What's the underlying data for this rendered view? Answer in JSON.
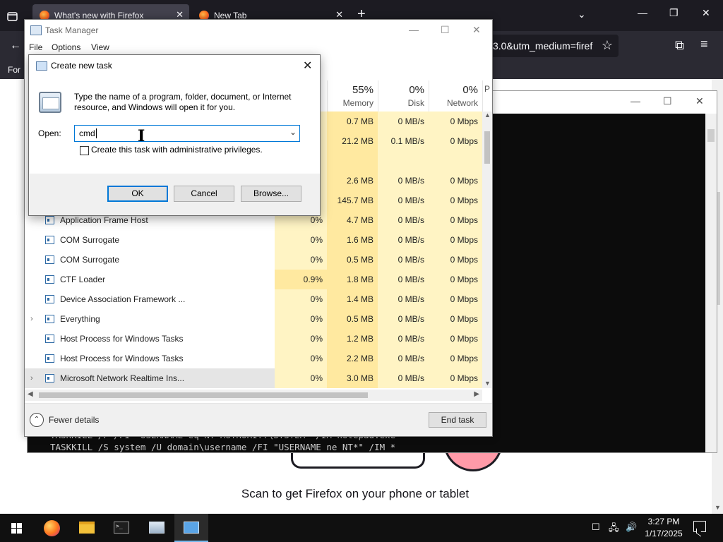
{
  "firefox": {
    "tabs": [
      {
        "title": "What's new with Firefox",
        "close": "✕"
      },
      {
        "title": "New Tab",
        "close": "✕"
      }
    ],
    "new_tab": "+",
    "all_tabs": "⌄",
    "window_controls": {
      "minimize": "—",
      "restore": "❐",
      "close": "✕"
    },
    "url_fragment": "3.0&utm_medium=firef",
    "bookmark_star": "☆",
    "bookmarks_text": "For",
    "back": "←",
    "extensions_icon": "⧉",
    "menu_icon": "≡",
    "page_text": "Scan to get Firefox on your phone or tablet"
  },
  "console": {
    "line1": "TASKKILL /F /FI \"USERNAME eq NT AUTHORITY\\SYSTEM\" /IM notepad.exe",
    "line2": "TASKKILL /S system /U domain\\username /FI \"USERNAME ne NT*\" /IM *",
    "controls": {
      "minimize": "—",
      "maximize": "☐",
      "close": "✕"
    }
  },
  "task_manager": {
    "title": "Task Manager",
    "controls": {
      "minimize": "—",
      "maximize": "☐",
      "close": "✕"
    },
    "menu": [
      "File",
      "Options",
      "View"
    ],
    "columns": [
      {
        "pct": "",
        "label": ""
      },
      {
        "pct": "55%",
        "label": "Memory"
      },
      {
        "pct": "0%",
        "label": "Disk"
      },
      {
        "pct": "0%",
        "label": "Network"
      },
      {
        "pct": "",
        "label": "P"
      }
    ],
    "rows": [
      {
        "name": "",
        "cpu": "",
        "mem": "0.7 MB",
        "disk": "0 MB/s",
        "net": "0 Mbps",
        "icon": false
      },
      {
        "name": "",
        "cpu": "",
        "mem": "21.2 MB",
        "disk": "0.1 MB/s",
        "net": "0 Mbps",
        "icon": false
      },
      {
        "name": "",
        "cpu": "",
        "mem": "",
        "disk": "",
        "net": "",
        "icon": false
      },
      {
        "name": "",
        "cpu": "",
        "mem": "2.6 MB",
        "disk": "0 MB/s",
        "net": "0 Mbps",
        "icon": false
      },
      {
        "name": "",
        "cpu": "",
        "mem": "145.7 MB",
        "disk": "0 MB/s",
        "net": "0 Mbps",
        "icon": false
      },
      {
        "name": "Application Frame Host",
        "cpu": "0%",
        "mem": "4.7 MB",
        "disk": "0 MB/s",
        "net": "0 Mbps",
        "icon": true
      },
      {
        "name": "COM Surrogate",
        "cpu": "0%",
        "mem": "1.6 MB",
        "disk": "0 MB/s",
        "net": "0 Mbps",
        "icon": true
      },
      {
        "name": "COM Surrogate",
        "cpu": "0%",
        "mem": "0.5 MB",
        "disk": "0 MB/s",
        "net": "0 Mbps",
        "icon": true
      },
      {
        "name": "CTF Loader",
        "cpu": "0.9%",
        "mem": "1.8 MB",
        "disk": "0 MB/s",
        "net": "0 Mbps",
        "icon": true
      },
      {
        "name": "Device Association Framework ...",
        "cpu": "0%",
        "mem": "1.4 MB",
        "disk": "0 MB/s",
        "net": "0 Mbps",
        "icon": true
      },
      {
        "name": "Everything",
        "cpu": "0%",
        "mem": "0.5 MB",
        "disk": "0 MB/s",
        "net": "0 Mbps",
        "icon": true,
        "expand": "›"
      },
      {
        "name": "Host Process for Windows Tasks",
        "cpu": "0%",
        "mem": "1.2 MB",
        "disk": "0 MB/s",
        "net": "0 Mbps",
        "icon": true
      },
      {
        "name": "Host Process for Windows Tasks",
        "cpu": "0%",
        "mem": "2.2 MB",
        "disk": "0 MB/s",
        "net": "0 Mbps",
        "icon": true
      },
      {
        "name": "Microsoft Network Realtime Ins...",
        "cpu": "0%",
        "mem": "3.0 MB",
        "disk": "0 MB/s",
        "net": "0 Mbps",
        "icon": true,
        "expand": "›"
      }
    ],
    "fewer_details": "Fewer details",
    "end_task": "End task",
    "colors": {
      "cpu_bg": "#fff4c4",
      "mem_bg": "#ffe9a0"
    }
  },
  "dialog": {
    "title": "Create new task",
    "close": "✕",
    "description": "Type the name of a program, folder, document, or Internet resource, and Windows will open it for you.",
    "open_label": "Open:",
    "open_value": "cmd",
    "dropdown": "⌄",
    "admin_label": "Create this task with administrative privileges.",
    "admin_checked": false,
    "ok": "OK",
    "cancel": "Cancel",
    "browse": "Browse...",
    "accent": "#0078d7"
  },
  "taskbar": {
    "clock_time": "3:27 PM",
    "clock_date": "1/17/2025",
    "tray": [
      "☐",
      "🖧",
      "🔊"
    ],
    "apps": [
      "firefox-icon",
      "file-explorer-icon",
      "terminal-icon",
      "run-dialog-icon",
      "task-manager-icon"
    ]
  }
}
